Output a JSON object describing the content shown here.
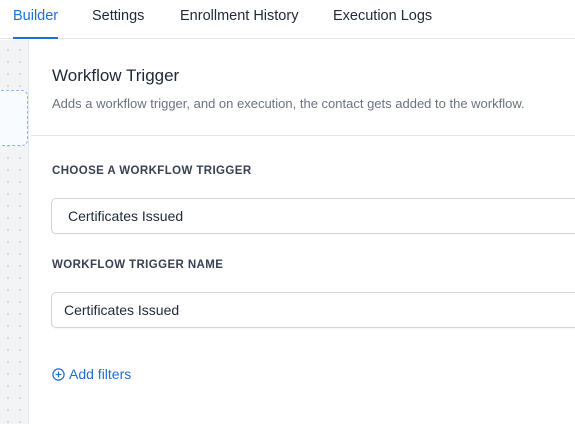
{
  "tabs": [
    {
      "label": "Builder",
      "active": true
    },
    {
      "label": "Settings",
      "active": false
    },
    {
      "label": "Enrollment History",
      "active": false
    },
    {
      "label": "Execution Logs",
      "active": false
    }
  ],
  "panel": {
    "title": "Workflow Trigger",
    "description": "Adds a workflow trigger, and on execution, the contact gets added to the workflow.",
    "trigger_select": {
      "label": "CHOOSE A WORKFLOW TRIGGER",
      "value": "Certificates Issued"
    },
    "trigger_name": {
      "label": "WORKFLOW TRIGGER NAME",
      "value": "Certificates Issued"
    },
    "add_filters_label": "Add filters",
    "add_filters_icon": "plus-circle-icon"
  },
  "colors": {
    "accent": "#1e6fd9",
    "text": "#1f2937",
    "muted": "#6b7280",
    "border": "#e5e7eb"
  }
}
